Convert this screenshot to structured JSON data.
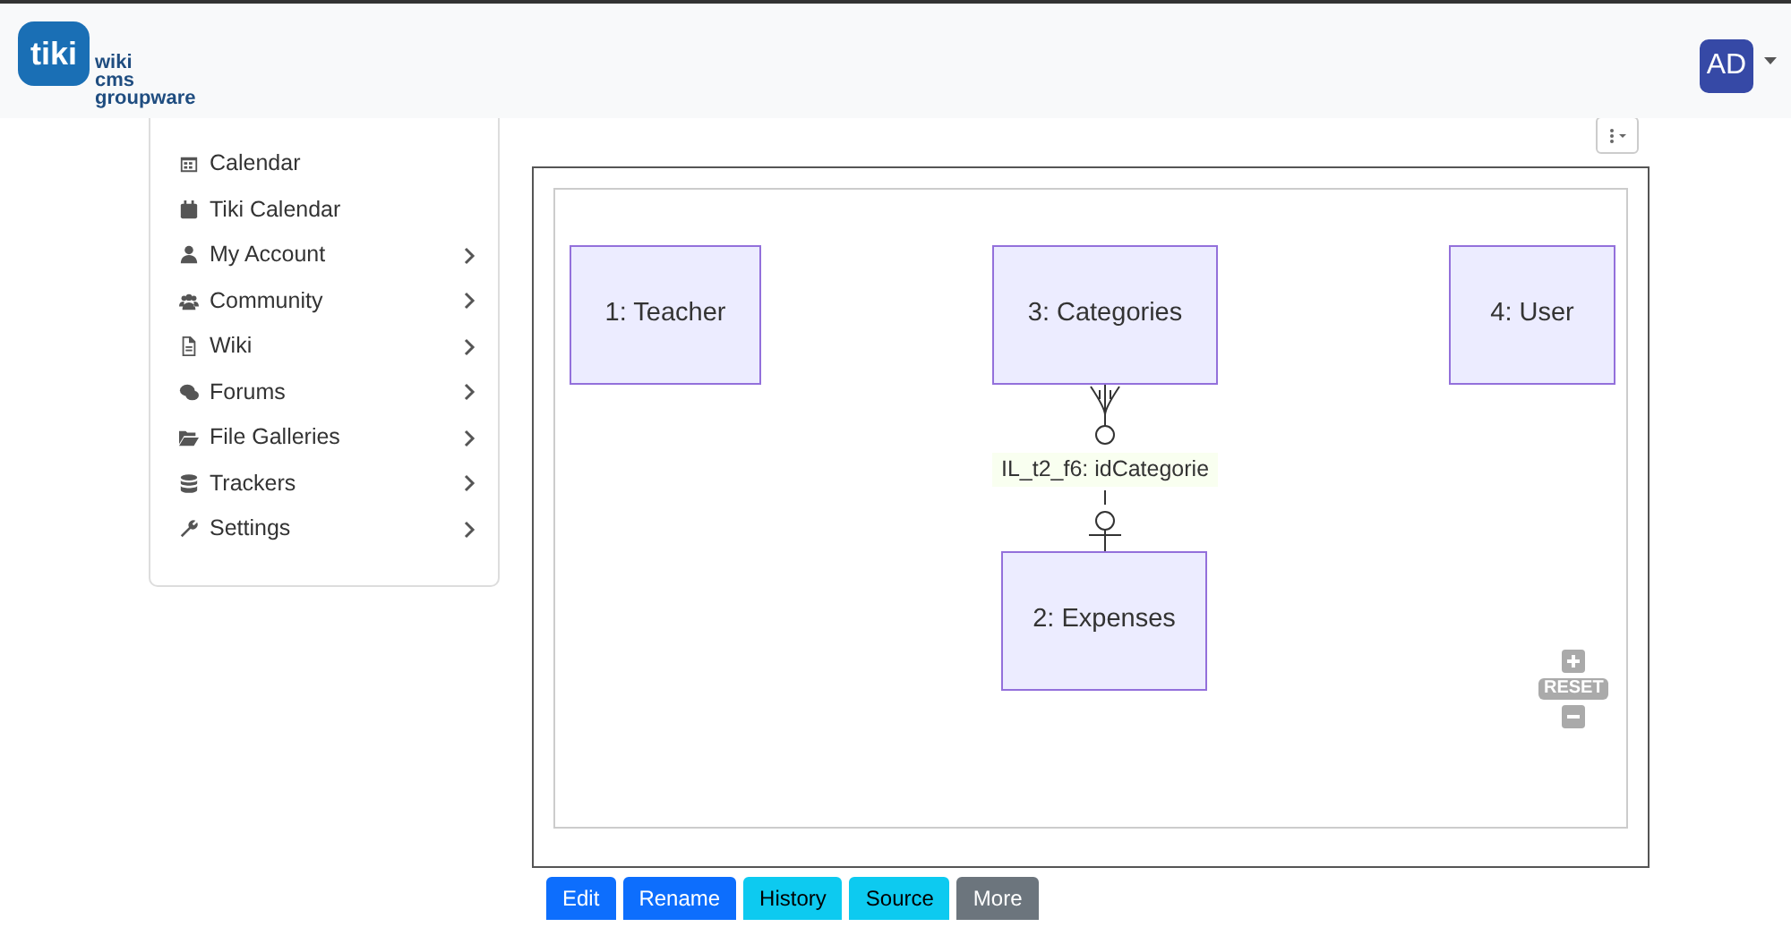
{
  "header": {
    "logo": {
      "mark": "tiki",
      "lines": [
        "wiki",
        "cms",
        "groupware"
      ]
    },
    "avatar": "AD"
  },
  "sidebar": {
    "items": [
      {
        "label": "Calendar",
        "submenu": false
      },
      {
        "label": "Tiki Calendar",
        "submenu": false
      },
      {
        "label": "My Account",
        "submenu": true
      },
      {
        "label": "Community",
        "submenu": true
      },
      {
        "label": "Wiki",
        "submenu": true
      },
      {
        "label": "Forums",
        "submenu": true
      },
      {
        "label": "File Galleries",
        "submenu": true
      },
      {
        "label": "Trackers",
        "submenu": true
      },
      {
        "label": "Settings",
        "submenu": true
      }
    ]
  },
  "diagram": {
    "entities": [
      {
        "label": "1: Teacher"
      },
      {
        "label": "3: Categories"
      },
      {
        "label": "4: User"
      },
      {
        "label": "2: Expenses"
      }
    ],
    "relationship": {
      "label": "IL_t2_f6: idCategorie"
    },
    "zoom_controls": {
      "reset": "RESET"
    }
  },
  "actions": [
    {
      "label": "Edit",
      "kind": "primary"
    },
    {
      "label": "Rename",
      "kind": "primary"
    },
    {
      "label": "History",
      "kind": "info"
    },
    {
      "label": "Source",
      "kind": "info"
    },
    {
      "label": "More",
      "kind": "secondary"
    }
  ]
}
